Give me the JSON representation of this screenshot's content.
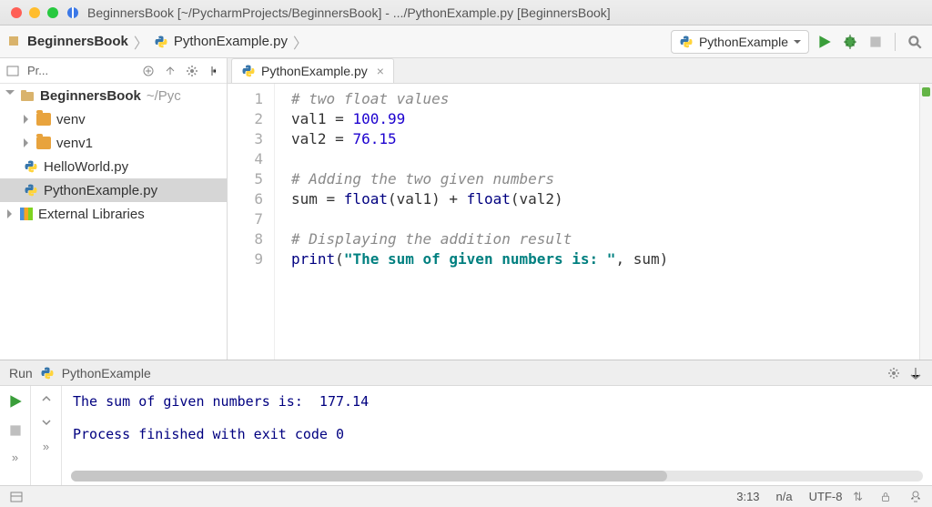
{
  "title": "BeginnersBook [~/PycharmProjects/BeginnersBook] - .../PythonExample.py [BeginnersBook]",
  "breadcrumb": {
    "project": "BeginnersBook",
    "file": "PythonExample.py"
  },
  "run_config": "PythonExample",
  "sidebar": {
    "header": "Pr...",
    "root": {
      "name": "BeginnersBook",
      "path": "~/Pyc"
    },
    "items": [
      {
        "kind": "folder",
        "label": "venv"
      },
      {
        "kind": "folder",
        "label": "venv1"
      },
      {
        "kind": "py",
        "label": "HelloWorld.py"
      },
      {
        "kind": "py",
        "label": "PythonExample.py",
        "selected": true
      }
    ],
    "external": "External Libraries"
  },
  "tab": {
    "label": "PythonExample.py"
  },
  "code": {
    "lines": [
      {
        "n": 1,
        "html": "<span class='cm-c'># two float values</span>"
      },
      {
        "n": 2,
        "html": "val1 = <span class='cm-n'>100.99</span>"
      },
      {
        "n": 3,
        "html": "val2 = <span class='cm-n'>76.15</span>",
        "hl": true
      },
      {
        "n": 4,
        "html": ""
      },
      {
        "n": 5,
        "html": "<span class='cm-c'># Adding the two given numbers</span>"
      },
      {
        "n": 6,
        "html": "sum = <span class='cm-b'>float</span>(val1) + <span class='cm-b'>float</span>(val2)"
      },
      {
        "n": 7,
        "html": ""
      },
      {
        "n": 8,
        "html": "<span class='cm-c'># Displaying the addition result</span>"
      },
      {
        "n": 9,
        "html": "<span class='cm-b'>print</span>(<span class='cm-s'>\"The sum of given numbers is: \"</span>, sum)"
      }
    ]
  },
  "run_panel": {
    "title_prefix": "Run",
    "title_config": "PythonExample",
    "output": [
      "The sum of given numbers is:  177.14",
      "",
      "Process finished with exit code 0"
    ]
  },
  "status": {
    "pos": "3:13",
    "insert": "n/a",
    "encoding": "UTF-8",
    "lock": "⏏"
  }
}
